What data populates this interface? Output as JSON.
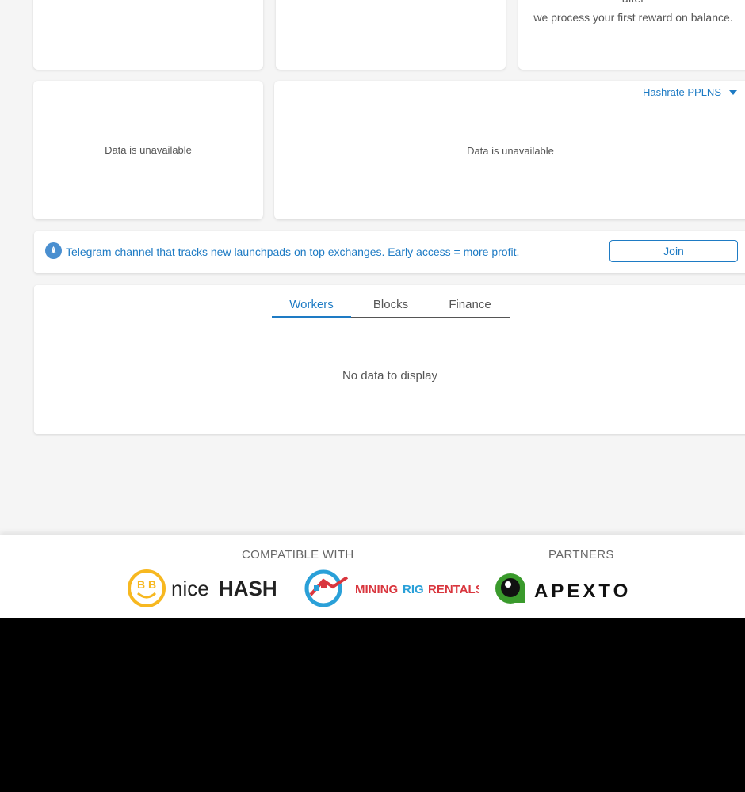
{
  "cards": {
    "top_right_line1": "after",
    "top_right_line2": "we process your first reward on balance."
  },
  "charts": {
    "left_unavailable": "Data is unavailable",
    "right_unavailable": "Data is unavailable",
    "hashrate_select": "Hashrate PPLNS"
  },
  "banner": {
    "text": "Telegram channel that tracks new launchpads on top exchanges. Early access = more profit.",
    "join_label": "Join"
  },
  "tabs": {
    "items": [
      "Workers",
      "Blocks",
      "Finance"
    ],
    "active": "Workers",
    "empty_text": "No data to display"
  },
  "footer": {
    "compatible_heading": "COMPATIBLE WITH",
    "partners_heading": "PARTNERS",
    "logos": {
      "nicehash_text": "niceHASH",
      "mrr_text": "MININGRIGRENTALS",
      "apexto_text": "APEXTO"
    }
  },
  "colors": {
    "accent": "#1e7bc4",
    "background": "#f5f5f5",
    "nicehash_yellow": "#f7b820",
    "mrr_red": "#d9363e",
    "mrr_blue": "#2aa0d8",
    "apexto_green": "#3a9a2c"
  }
}
